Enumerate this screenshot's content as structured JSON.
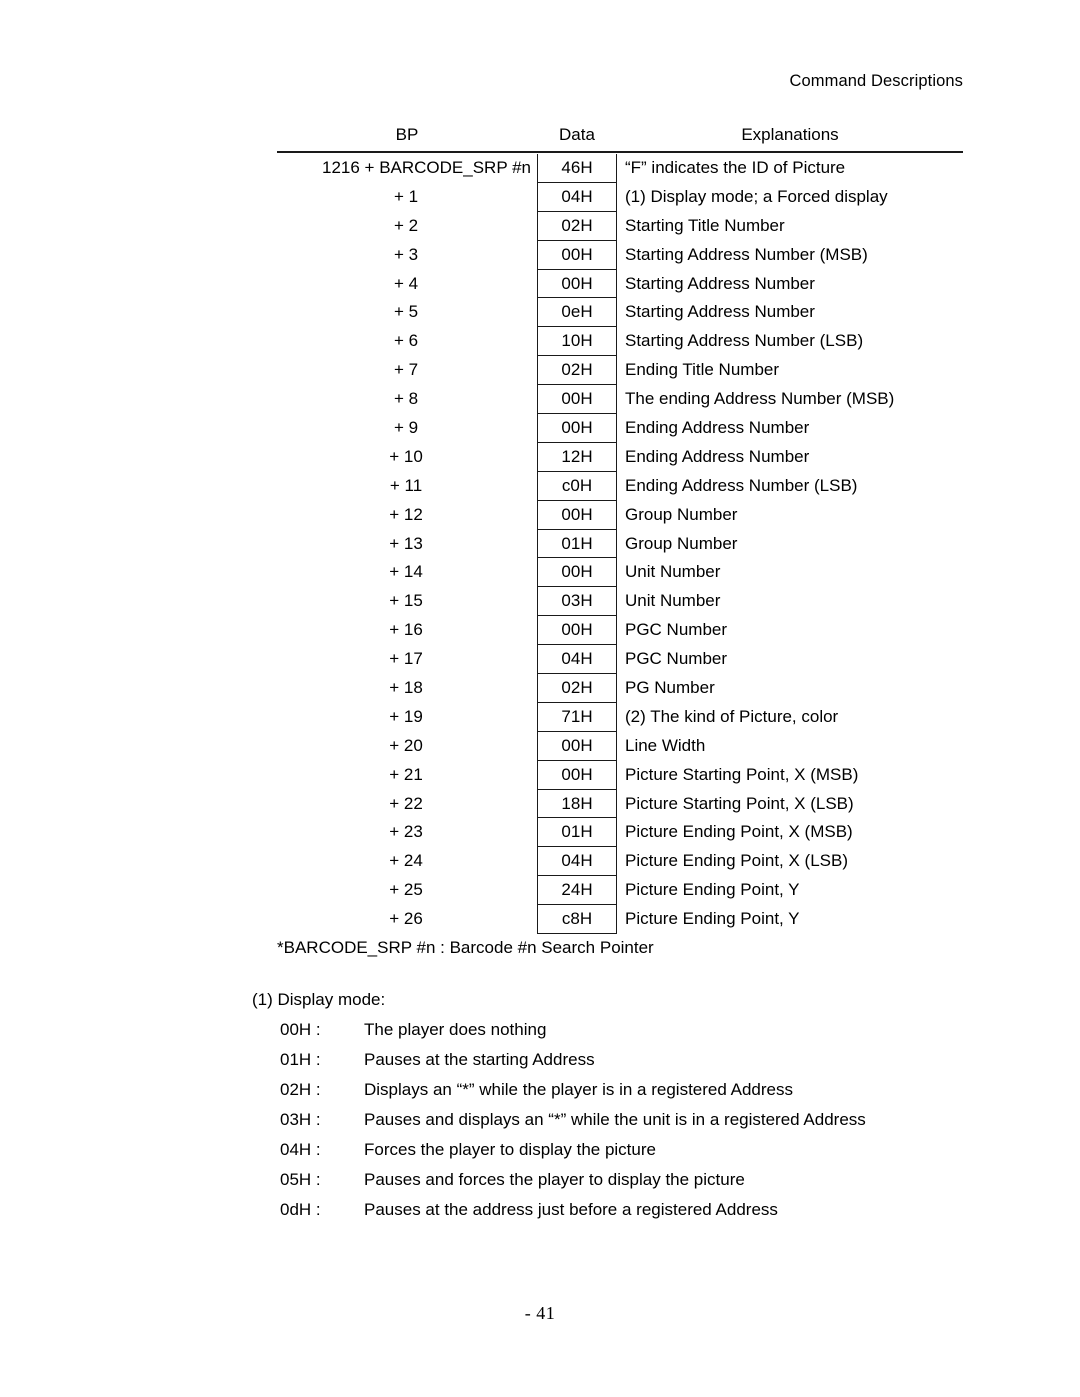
{
  "document": {
    "running_head": "Command Descriptions",
    "page_number": "- 41"
  },
  "table": {
    "headers": {
      "bp": "BP",
      "data": "Data",
      "explanations": "Explanations"
    },
    "rows": [
      {
        "bp": "1216 + BARCODE_SRP #n",
        "data": "46H",
        "explanation": "“F” indicates the ID of Picture"
      },
      {
        "bp": "+ 1",
        "data": "04H",
        "explanation": "(1) Display mode; a Forced display"
      },
      {
        "bp": "+ 2",
        "data": "02H",
        "explanation": "Starting Title Number"
      },
      {
        "bp": "+ 3",
        "data": "00H",
        "explanation": "Starting Address Number (MSB)"
      },
      {
        "bp": "+ 4",
        "data": "00H",
        "explanation": "Starting Address Number"
      },
      {
        "bp": "+ 5",
        "data": "0eH",
        "explanation": "Starting Address Number"
      },
      {
        "bp": "+ 6",
        "data": "10H",
        "explanation": "Starting Address Number (LSB)"
      },
      {
        "bp": "+ 7",
        "data": "02H",
        "explanation": "Ending Title Number"
      },
      {
        "bp": "+ 8",
        "data": "00H",
        "explanation": "The ending Address Number (MSB)"
      },
      {
        "bp": "+ 9",
        "data": "00H",
        "explanation": "Ending Address Number"
      },
      {
        "bp": "+ 10",
        "data": "12H",
        "explanation": "Ending Address Number"
      },
      {
        "bp": "+ 11",
        "data": "c0H",
        "explanation": "Ending Address Number (LSB)"
      },
      {
        "bp": "+ 12",
        "data": "00H",
        "explanation": "Group Number"
      },
      {
        "bp": "+ 13",
        "data": "01H",
        "explanation": "Group Number"
      },
      {
        "bp": "+ 14",
        "data": "00H",
        "explanation": " Unit Number"
      },
      {
        "bp": "+ 15",
        "data": "03H",
        "explanation": "Unit Number"
      },
      {
        "bp": "+ 16",
        "data": "00H",
        "explanation": "PGC Number"
      },
      {
        "bp": "+ 17",
        "data": "04H",
        "explanation": "PGC Number"
      },
      {
        "bp": "+ 18",
        "data": "02H",
        "explanation": "PG Number"
      },
      {
        "bp": "+ 19",
        "data": "71H",
        "explanation": "(2) The kind of Picture, color"
      },
      {
        "bp": "+ 20",
        "data": "00H",
        "explanation": "Line Width"
      },
      {
        "bp": "+ 21",
        "data": "00H",
        "explanation": "Picture Starting Point, X (MSB)"
      },
      {
        "bp": "+ 22",
        "data": "18H",
        "explanation": "Picture Starting Point, X (LSB)"
      },
      {
        "bp": "+ 23",
        "data": "01H",
        "explanation": "Picture Ending Point, X (MSB)"
      },
      {
        "bp": "+ 24",
        "data": "04H",
        "explanation": "Picture Ending Point, X (LSB)"
      },
      {
        "bp": "+ 25",
        "data": "24H",
        "explanation": "Picture Ending Point, Y"
      },
      {
        "bp": "+ 26",
        "data": "c8H",
        "explanation": "Picture Ending Point, Y"
      }
    ],
    "note": "*BARCODE_SRP #n : Barcode #n Search Pointer"
  },
  "display_mode": {
    "title": "(1) Display mode:",
    "entries": [
      {
        "code": "00H :",
        "text": "The player does nothing"
      },
      {
        "code": "01H :",
        "text": "Pauses at the starting Address"
      },
      {
        "code": "02H :",
        "text": "Displays an “*” while the player is in a registered Address"
      },
      {
        "code": "03H :",
        "text": "Pauses and displays an “*” while the unit is in a registered Address"
      },
      {
        "code": "04H :",
        "text": "Forces the player to display the picture"
      },
      {
        "code": "05H :",
        "text": "Pauses and forces the player to display the picture"
      },
      {
        "code": "0dH :",
        "text": "Pauses at the address just before a registered Address"
      }
    ]
  }
}
